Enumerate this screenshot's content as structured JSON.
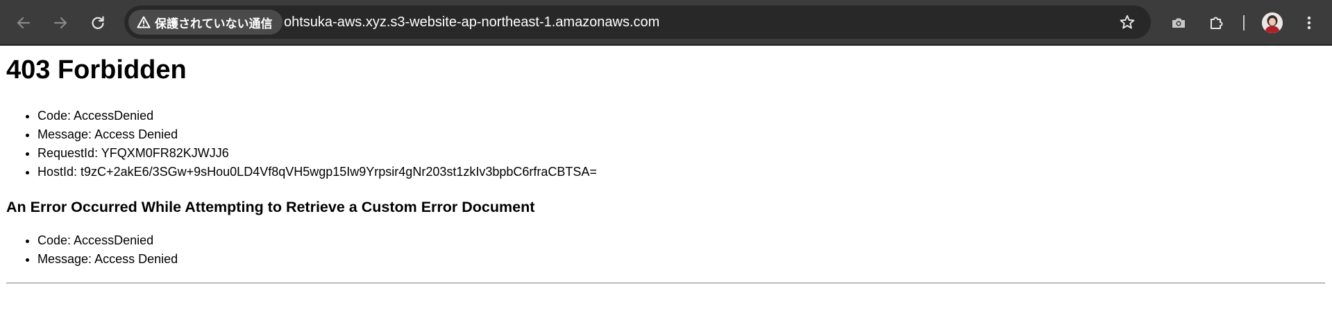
{
  "browser": {
    "security_chip_label": "保護されていない通信",
    "url": "ohtsuka-aws.xyz.s3-website-ap-northeast-1.amazonaws.com",
    "icons": {
      "back": "arrow-left-icon",
      "forward": "arrow-right-icon",
      "reload": "reload-icon",
      "warning": "warning-triangle-icon",
      "bookmark": "star-icon",
      "camera": "camera-icon",
      "extensions": "puzzle-icon",
      "profile": "avatar",
      "menu": "kebab-menu-icon"
    },
    "colors": {
      "toolbar_bg": "#3c3c3c",
      "omnibox_bg": "#282828",
      "chip_bg": "#4a4a4a"
    }
  },
  "page": {
    "title": "403 Forbidden",
    "details": [
      {
        "label": "Code",
        "value": "AccessDenied"
      },
      {
        "label": "Message",
        "value": "Access Denied"
      },
      {
        "label": "RequestId",
        "value": "YFQXM0FR82KJWJJ6"
      },
      {
        "label": "HostId",
        "value": "t9zC+2akE6/3SGw+9sHou0LD4Vf8qVH5wgp15Iw9Yrpsir4gNr203st1zkIv3bpbC6rfraCBTSA="
      }
    ],
    "subheading": "An Error Occurred While Attempting to Retrieve a Custom Error Document",
    "error_document_details": [
      {
        "label": "Code",
        "value": "AccessDenied"
      },
      {
        "label": "Message",
        "value": "Access Denied"
      }
    ]
  }
}
